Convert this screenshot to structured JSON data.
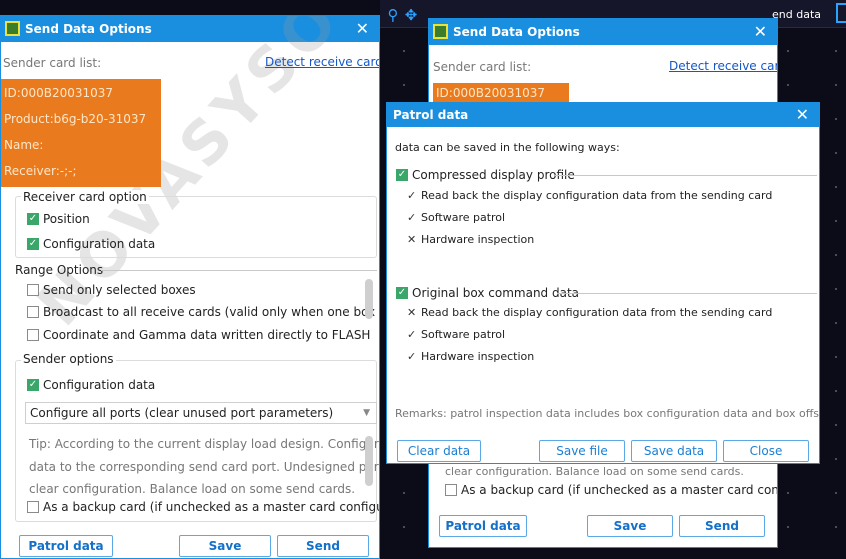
{
  "toolbar": {
    "right_text": "end data"
  },
  "left_dialog": {
    "title": "Send Data Options",
    "sender_card_list_label": "Sender card list:",
    "detect_link": "Detect receive cards",
    "card": {
      "id": "ID:000B20031037",
      "product": "Product:b6g-b20-31037",
      "name": "Name:",
      "receiver": "Receiver:-;-;"
    },
    "receiver_option": {
      "label": "Receiver card option",
      "position": "Position",
      "configuration": "Configuration data"
    },
    "range_options": {
      "label": "Range Options",
      "send_selected": "Send only selected boxes",
      "broadcast": "Broadcast to all receive cards (valid only when one box is s",
      "coordinate": "Coordinate and Gamma data written directly to FLASH"
    },
    "sender_options": {
      "label": "Sender options",
      "configuration": "Configuration data",
      "select_value": "Configure all ports (clear unused port parameters)",
      "tip_line1": "Tip: According to the current display load design. Configure",
      "tip_line2": "data to the corresponding send card port. Undesigned ports",
      "tip_line3": "clear configuration. Balance load on some send cards.",
      "backup": "As a backup card (if unchecked as a master card configuratio"
    },
    "buttons": {
      "patrol": "Patrol data",
      "save": "Save",
      "send": "Send"
    },
    "watermark": "NOVASYSO"
  },
  "right_dialog": {
    "title": "Send Data Options",
    "sender_card_list_label": "Sender card list:",
    "detect_link": "Detect receive cards",
    "card_id": "ID:000B20031037",
    "tip_tail": "clear configuration. Balance load on some send cards.",
    "backup": "As a backup card (if unchecked as a master card configuratio",
    "buttons": {
      "patrol": "Patrol data",
      "save": "Save",
      "send": "Send"
    }
  },
  "patrol_dialog": {
    "title": "Patrol data",
    "intro": "data can be saved in the following ways:",
    "compressed": {
      "label": "Compressed display profile",
      "items": [
        {
          "mark": "✓",
          "text": "Read back the display configuration data from the sending card"
        },
        {
          "mark": "✓",
          "text": "Software patrol"
        },
        {
          "mark": "✕",
          "text": "Hardware inspection"
        }
      ]
    },
    "original": {
      "label": "Original box command data",
      "items": [
        {
          "mark": "✕",
          "text": "Read back the display configuration data from the sending card"
        },
        {
          "mark": "✓",
          "text": "Software patrol"
        },
        {
          "mark": "✓",
          "text": "Hardware inspection"
        }
      ]
    },
    "remarks": "Remarks: patrol inspection data includes box configuration data and box offset",
    "buttons": {
      "clear": "Clear data",
      "save_file": "Save file",
      "save_data": "Save data",
      "close": "Close"
    }
  },
  "icons": {
    "close": "✕",
    "check": "✓",
    "move": "✥",
    "search": "⚲",
    "dropdown": "▼"
  },
  "colors": {
    "accent": "#1a8fe0",
    "card": "#ea7a1e",
    "checked": "#3aa66a"
  }
}
